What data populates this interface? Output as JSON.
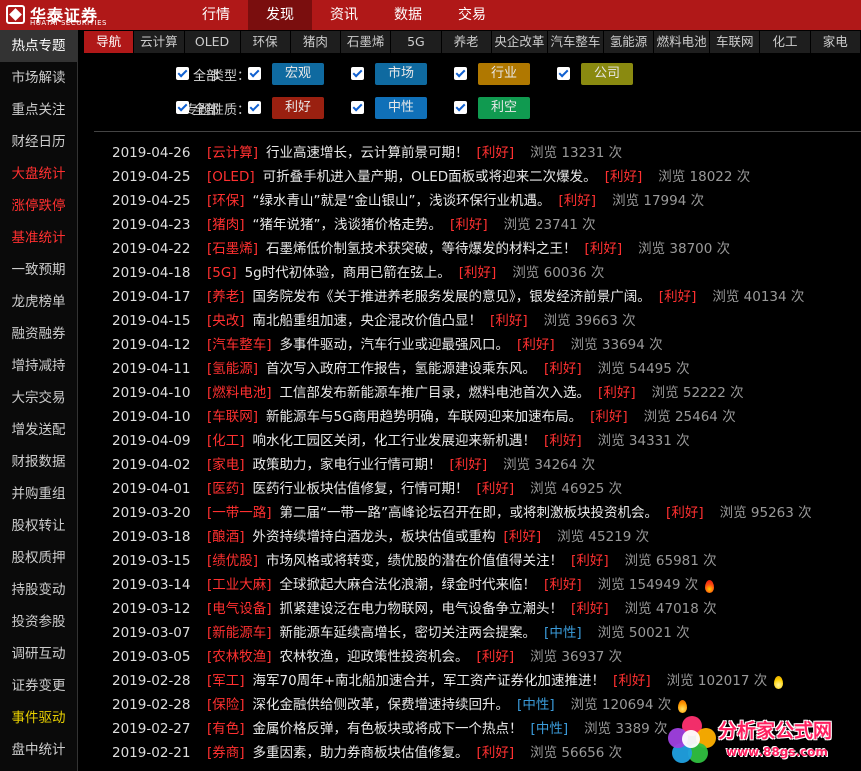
{
  "brand": {
    "name_cn": "华泰证券",
    "name_en": "HUATAI SECURITIES"
  },
  "main_nav": [
    "行情",
    "发现",
    "资讯",
    "数据",
    "交易"
  ],
  "main_nav_active": 1,
  "sidebar": {
    "items": [
      "热点专题",
      "市场解读",
      "重点关注",
      "财经日历",
      "大盘统计",
      "涨停跌停",
      "基准统计",
      "一致预期",
      "龙虎榜单",
      "融资融券",
      "增持减持",
      "大宗交易",
      "增发送配",
      "财报数据",
      "并购重组",
      "股权转让",
      "股权质押",
      "持股变动",
      "投资参股",
      "调研互动",
      "证券变更",
      "事件驱动",
      "盘中统计"
    ],
    "active": 0,
    "red_items": [
      4,
      5,
      6
    ],
    "yellow_items": [
      21
    ]
  },
  "category_tabs": [
    "导航",
    "云计算",
    "OLED",
    "环保",
    "猪肉",
    "石墨烯",
    "5G",
    "养老",
    "央企改革",
    "汽车整车",
    "氢能源",
    "燃料电池",
    "车联网",
    "化工",
    "家电"
  ],
  "category_active": 0,
  "filters": {
    "type": {
      "label": "类型：",
      "all": "全部",
      "options": [
        {
          "label": "宏观",
          "color": "#0f6aa0"
        },
        {
          "label": "市场",
          "color": "#0f6aa0"
        },
        {
          "label": "行业",
          "color": "#b07800"
        },
        {
          "label": "公司",
          "color": "#8a8a10"
        }
      ]
    },
    "nature": {
      "label": "专题性质：",
      "all": "全部",
      "options": [
        {
          "label": "利好",
          "color": "#9a2010"
        },
        {
          "label": "中性",
          "color": "#1070b8"
        },
        {
          "label": "利空",
          "color": "#109a50"
        }
      ]
    }
  },
  "views_prefix": "浏览",
  "views_suffix": "次",
  "news": [
    {
      "date": "2019-04-26",
      "tag": "[云计算]",
      "title": "行业高速增长，云计算前景可期！",
      "sentiment": "[利好]",
      "sentiment_type": "bull",
      "views": "13231"
    },
    {
      "date": "2019-04-25",
      "tag": "[OLED]",
      "title": "可折叠手机进入量产期，OLED面板或将迎来二次爆发。",
      "sentiment": "[利好]",
      "sentiment_type": "bull",
      "views": "18022"
    },
    {
      "date": "2019-04-25",
      "tag": "[环保]",
      "title": "“绿水青山”就是“金山银山”，浅谈环保行业机遇。",
      "sentiment": "[利好]",
      "sentiment_type": "bull",
      "views": "17994"
    },
    {
      "date": "2019-04-23",
      "tag": "[猪肉]",
      "title": "“猪年说猪”，浅谈猪价格走势。",
      "sentiment": "[利好]",
      "sentiment_type": "bull",
      "views": "23741"
    },
    {
      "date": "2019-04-22",
      "tag": "[石墨烯]",
      "title": "石墨烯低价制氢技术获突破，等待爆发的材料之王！",
      "sentiment": "[利好]",
      "sentiment_type": "bull",
      "views": "38700"
    },
    {
      "date": "2019-04-18",
      "tag": "[5G]",
      "title": "5g时代初体验，商用已箭在弦上。",
      "sentiment": "[利好]",
      "sentiment_type": "bull",
      "views": "60036"
    },
    {
      "date": "2019-04-17",
      "tag": "[养老]",
      "title": "国务院发布《关于推进养老服务发展的意见》，银发经济前景广阔。",
      "sentiment": "[利好]",
      "sentiment_type": "bull",
      "views": "40134"
    },
    {
      "date": "2019-04-15",
      "tag": "[央改]",
      "title": "南北船重组加速，央企混改价值凸显！",
      "sentiment": "[利好]",
      "sentiment_type": "bull",
      "views": "39663"
    },
    {
      "date": "2019-04-12",
      "tag": "[汽车整车]",
      "title": "多事件驱动，汽车行业或迎最强风口。",
      "sentiment": "[利好]",
      "sentiment_type": "bull",
      "views": "33694"
    },
    {
      "date": "2019-04-11",
      "tag": "[氢能源]",
      "title": "首次写入政府工作报告，氢能源建设乘东风。",
      "sentiment": "[利好]",
      "sentiment_type": "bull",
      "views": "54495"
    },
    {
      "date": "2019-04-10",
      "tag": "[燃料电池]",
      "title": "工信部发布新能源车推广目录，燃料电池首次入选。",
      "sentiment": "[利好]",
      "sentiment_type": "bull",
      "views": "52222"
    },
    {
      "date": "2019-04-10",
      "tag": "[车联网]",
      "title": "新能源车与5G商用趋势明确，车联网迎来加速布局。",
      "sentiment": "[利好]",
      "sentiment_type": "bull",
      "views": "25464"
    },
    {
      "date": "2019-04-09",
      "tag": "[化工]",
      "title": "响水化工园区关闭，化工行业发展迎来新机遇！",
      "sentiment": "[利好]",
      "sentiment_type": "bull",
      "views": "34331"
    },
    {
      "date": "2019-04-02",
      "tag": "[家电]",
      "title": "政策助力，家电行业行情可期！",
      "sentiment": "[利好]",
      "sentiment_type": "bull",
      "views": "34264"
    },
    {
      "date": "2019-04-01",
      "tag": "[医药]",
      "title": "医药行业板块估值修复，行情可期！",
      "sentiment": "[利好]",
      "sentiment_type": "bull",
      "views": "46925"
    },
    {
      "date": "2019-03-20",
      "tag": "[一带一路]",
      "title": "第二届“一带一路”高峰论坛召开在即，或将刺激板块投资机会。",
      "sentiment": "[利好]",
      "sentiment_type": "bull",
      "views": "95263"
    },
    {
      "date": "2019-03-18",
      "tag": "[酿酒]",
      "title": "外资持续增持白酒龙头，板块估值或重构",
      "sentiment": "[利好]",
      "sentiment_type": "bull",
      "views": "45219"
    },
    {
      "date": "2019-03-15",
      "tag": "[绩优股]",
      "title": "市场风格或将转变，绩优股的潜在价值值得关注！",
      "sentiment": "[利好]",
      "sentiment_type": "bull",
      "views": "65981"
    },
    {
      "date": "2019-03-14",
      "tag": "[工业大麻]",
      "title": "全球掀起大麻合法化浪潮，绿金时代来临！",
      "sentiment": "[利好]",
      "sentiment_type": "bull",
      "views": "154949",
      "hot": "red"
    },
    {
      "date": "2019-03-12",
      "tag": "[电气设备]",
      "title": "抓紧建设泛在电力物联网，电气设备争立潮头！",
      "sentiment": "[利好]",
      "sentiment_type": "bull",
      "views": "47018"
    },
    {
      "date": "2019-03-07",
      "tag": "[新能源车]",
      "title": "新能源车延续高增长，密切关注两会提案。",
      "sentiment": "[中性]",
      "sentiment_type": "neutral",
      "views": "50021"
    },
    {
      "date": "2019-03-05",
      "tag": "[农林牧渔]",
      "title": "农林牧渔，迎政策性投资机会。",
      "sentiment": "[利好]",
      "sentiment_type": "bull",
      "views": "36937"
    },
    {
      "date": "2019-02-28",
      "tag": "[军工]",
      "title": "海军70周年+南北船加速合并，军工资产证券化加速推进！",
      "sentiment": "[利好]",
      "sentiment_type": "bull",
      "views": "102017",
      "hot": "yellow"
    },
    {
      "date": "2019-02-28",
      "tag": "[保险]",
      "title": "深化金融供给侧改革，保费增速持续回升。",
      "sentiment": "[中性]",
      "sentiment_type": "neutral",
      "views": "120694",
      "hot": "orange"
    },
    {
      "date": "2019-02-27",
      "tag": "[有色]",
      "title": "金属价格反弹，有色板块或将成下一个热点！",
      "sentiment": "[中性]",
      "sentiment_type": "neutral",
      "views": "3389"
    },
    {
      "date": "2019-02-21",
      "tag": "[券商]",
      "title": "多重因素，助力券商板块估值修复。",
      "sentiment": "[利好]",
      "sentiment_type": "bull",
      "views": "56656"
    }
  ],
  "watermark": {
    "name": "分析家公式网",
    "url": "www.88gs.com"
  }
}
